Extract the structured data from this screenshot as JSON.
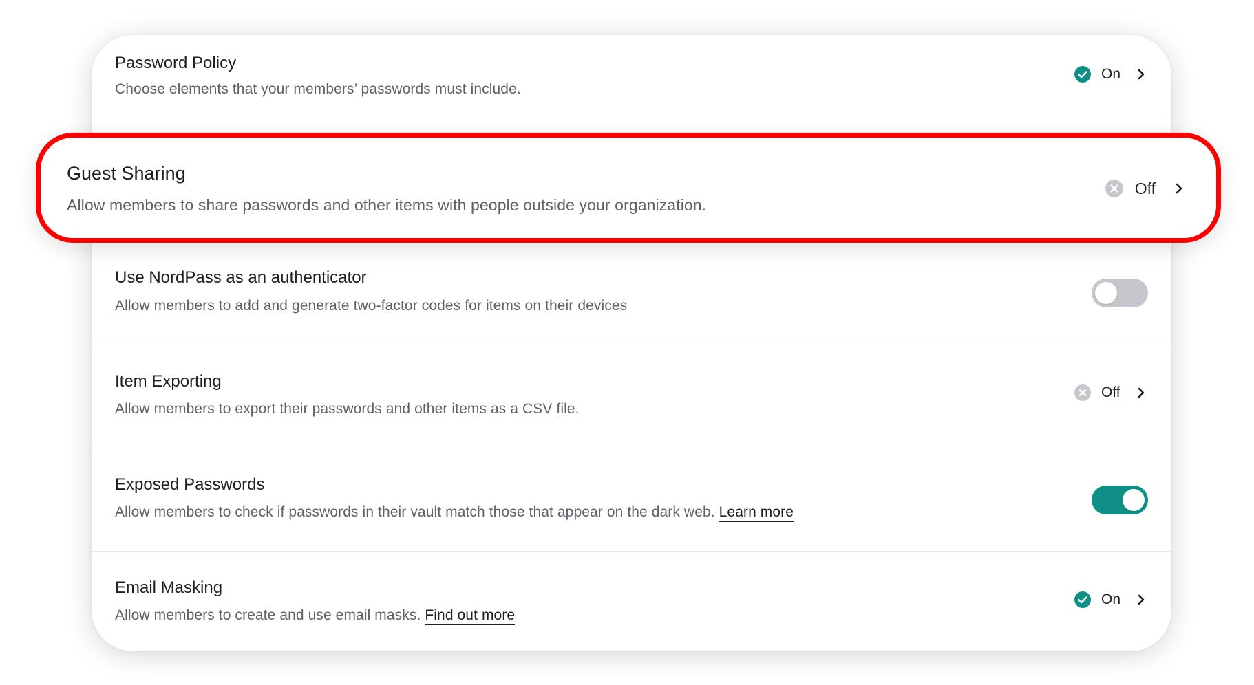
{
  "policies": [
    {
      "title": "Password Policy",
      "description": "Choose elements that your members’ passwords must include.",
      "control": "status",
      "status": "On"
    },
    {
      "title": "Guest Sharing",
      "description": "Allow members to share passwords and other items with people outside your organization.",
      "control": "status",
      "status": "Off",
      "highlighted": true
    },
    {
      "title": "Use NordPass as an authenticator",
      "description": "Allow members to add and generate two-factor codes for items on their devices",
      "control": "toggle",
      "toggle_on": false
    },
    {
      "title": "Item Exporting",
      "description": "Allow members to export their passwords and other items as a CSV file.",
      "control": "status",
      "status": "Off"
    },
    {
      "title": "Exposed Passwords",
      "description": "Allow members to check if passwords in their vault match those that appear on the dark web.",
      "link": "Learn more",
      "control": "toggle",
      "toggle_on": true
    },
    {
      "title": "Email Masking",
      "description": "Allow members to create and use email masks.",
      "link": "Find out more",
      "control": "status",
      "status": "On"
    }
  ],
  "colors": {
    "accent_teal": "#0f8f86",
    "status_off_gray": "#c6c7cc",
    "highlight_red": "#ff0000"
  },
  "icons": {
    "on": "check-circle-icon",
    "off": "x-circle-icon",
    "chevron": "chevron-right-icon"
  }
}
